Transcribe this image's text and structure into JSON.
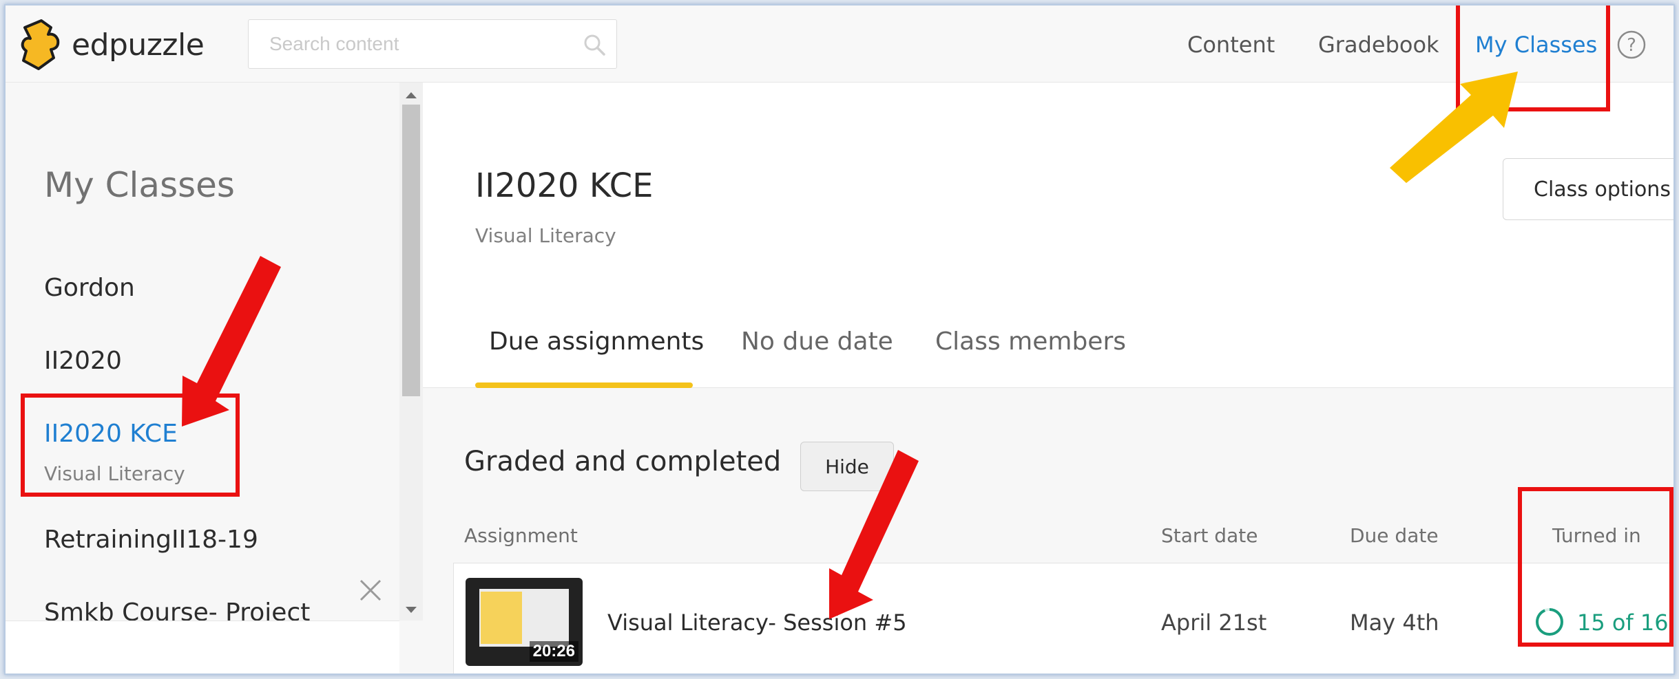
{
  "header": {
    "logo_text": "edpuzzle",
    "search_placeholder": "Search content",
    "nav": {
      "content": "Content",
      "gradebook": "Gradebook",
      "my_classes": "My Classes"
    }
  },
  "sidebar": {
    "title": "My Classes",
    "classes": [
      {
        "name": "Gordon"
      },
      {
        "name": "II2020"
      },
      {
        "name": "II2020 KCE",
        "subtitle": "Visual Literacy",
        "active": true
      },
      {
        "name": "RetrainingII18-19"
      },
      {
        "name": "Smkb Course- Project"
      }
    ]
  },
  "main": {
    "class_title": "II2020 KCE",
    "class_subtitle": "Visual Literacy",
    "class_options": "Class options",
    "tabs": [
      "Due assignments",
      "No due date",
      "Class members"
    ],
    "section": {
      "title": "Graded and completed",
      "hide_label": "Hide"
    },
    "columns": {
      "assignment": "Assignment",
      "start": "Start date",
      "due": "Due date",
      "turned": "Turned in"
    },
    "assignments": [
      {
        "title": "Visual Literacy- Session #5",
        "duration": "20:26",
        "start_date": "April 21st",
        "due_date": "May 4th",
        "turned_in": "15 of 16",
        "turned_in_fraction": 0.9375
      }
    ]
  },
  "colors": {
    "accent_blue": "#1f7fd1",
    "tab_underline": "#f4c21b",
    "progress_green": "#1a9e7e",
    "annotation_red": "#ea1111",
    "annotation_yellow": "#f9c000"
  }
}
